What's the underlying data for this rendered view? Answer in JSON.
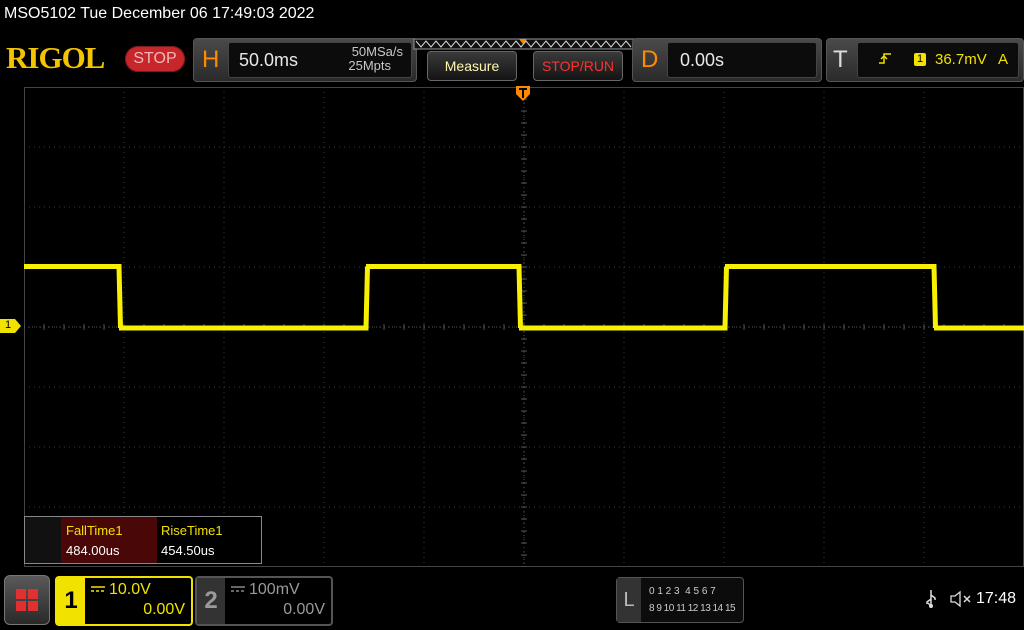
{
  "title": "MSO5102  Tue December 06 17:49:03 2022",
  "brand": "RIGOL",
  "status": "STOP",
  "horizontal": {
    "letter": "H",
    "timebase": "50.0ms",
    "sample_rate": "50MSa/s",
    "memory_depth": "25Mpts"
  },
  "buttons": {
    "measure": "Measure",
    "stop_run": "STOP/RUN"
  },
  "delay": {
    "letter": "D",
    "value": "0.00s"
  },
  "trigger": {
    "letter": "T",
    "source": "1",
    "level": "36.7mV",
    "mode": "A"
  },
  "channel_marker": "1",
  "measurements": [
    {
      "name": "FallTime1",
      "value": "484.00us"
    },
    {
      "name": "RiseTime1",
      "value": "454.50us"
    }
  ],
  "channels": [
    {
      "number": "1",
      "scale": "10.0V",
      "offset": "0.00V",
      "color": "#f2e200",
      "active": true
    },
    {
      "number": "2",
      "scale": "100mV",
      "offset": "0.00V",
      "color": "#8a8a8a",
      "active": false
    }
  ],
  "logic": {
    "letter": "L",
    "row1": "0 1 2 3  4 5 6 7",
    "row2": "8 9 10 11 12 13 14 15"
  },
  "clock": "17:48",
  "waveform": {
    "color": "#f7f000",
    "edges_fraction": [
      0.0,
      0.095,
      0.342,
      0.495,
      0.701,
      0.91
    ],
    "start_level": "high"
  }
}
